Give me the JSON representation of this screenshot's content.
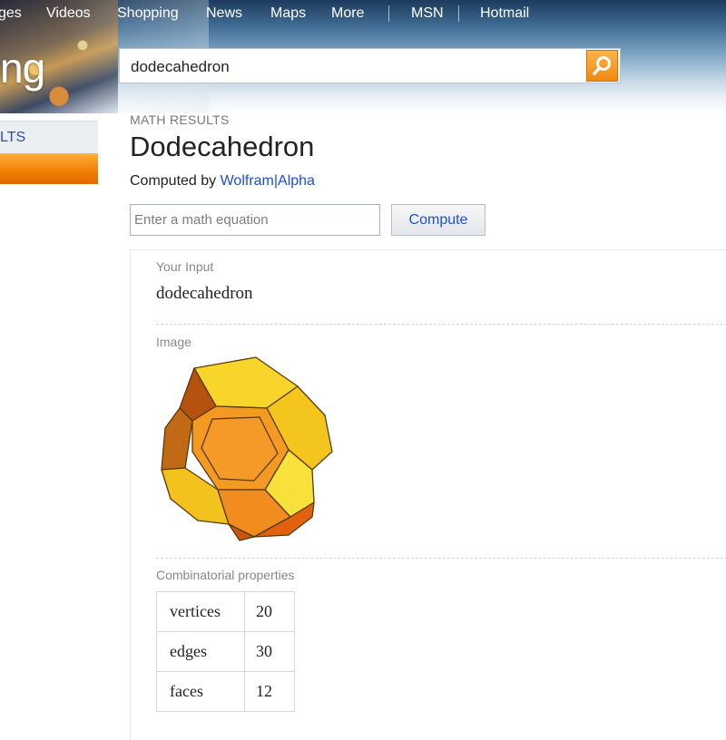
{
  "nav": {
    "items": [
      {
        "label": "ges"
      },
      {
        "label": "Videos"
      },
      {
        "label": "Shopping"
      },
      {
        "label": "News"
      },
      {
        "label": "Maps"
      },
      {
        "label": "More"
      },
      {
        "label": "MSN"
      },
      {
        "label": "Hotmail"
      }
    ]
  },
  "logo": {
    "text": "ng"
  },
  "search": {
    "query": "dodecahedron",
    "button_icon": "search-icon"
  },
  "sidebar": {
    "results_label": "LTS"
  },
  "header": {
    "section_label": "MATH RESULTS",
    "title": "Dodecahedron",
    "computed_prefix": "Computed by ",
    "computed_link": "Wolfram|Alpha"
  },
  "math_input": {
    "placeholder": "Enter a math equation",
    "value": ""
  },
  "compute_button": {
    "label": "Compute"
  },
  "pods": {
    "your_input": {
      "label": "Your Input",
      "value": "dodecahedron"
    },
    "image": {
      "label": "Image",
      "icon": "dodecahedron-image"
    },
    "combinatorial": {
      "label": "Combinatorial properties",
      "rows": [
        {
          "key": "vertices",
          "value": "20"
        },
        {
          "key": "edges",
          "value": "30"
        },
        {
          "key": "faces",
          "value": "12"
        }
      ]
    }
  },
  "colors": {
    "accent_orange": "#f08a12",
    "link_blue": "#1a4fd6",
    "face_yellow": "#f6d51e",
    "face_orange": "#f59a2a"
  }
}
